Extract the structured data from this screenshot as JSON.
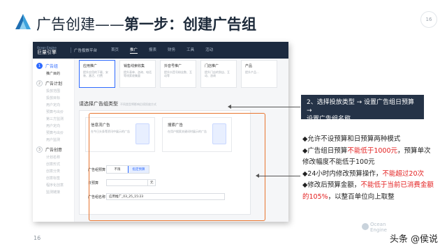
{
  "slide": {
    "title_prefix": "广告创建——",
    "title_bold": "第一步：创建广告组",
    "page_badge": "16",
    "page_number": "16",
    "watermark_line1": "Ocean",
    "watermark_line2": "Engine",
    "corner_credit": "头条 @侯说"
  },
  "screenshot": {
    "brand_en": "Ocean Engine",
    "brand_cn": "巨量引擎",
    "platform": "广告投放平台",
    "nav": [
      "首页",
      "推广",
      "报表",
      "财务",
      "工具",
      "活动"
    ],
    "nav_active_index": 1,
    "sidebar": {
      "steps": [
        {
          "num": "1",
          "label": "广告组",
          "subs": [
            "推广目的"
          ]
        },
        {
          "num": "2",
          "label": "广告计划",
          "subs": [
            "投放范围",
            "投放目标",
            "用户定向",
            "预算与出价",
            "第三方监测",
            "用户定向",
            "预算与出价",
            "用户监测"
          ]
        },
        {
          "num": "3",
          "label": "广告创意",
          "subs": [
            "计划名称",
            "创意形式",
            "创意分类",
            "创意标签",
            "程序化创意",
            "监测链接"
          ]
        }
      ]
    },
    "top_cards": [
      {
        "title": "应用推广",
        "desc": "提升应用的下载、安装、激活、付费"
      },
      {
        "title": "销售线索收集",
        "desc": "提升表单、咨询、电话等线索收集量"
      },
      {
        "title": "抖音号推广",
        "desc": "提升抖音号粉丝数、互动等"
      },
      {
        "title": "门店推广",
        "desc": "提升门店的到店、互动、咨询"
      },
      {
        "title": "产品",
        "desc": "提升产品..."
      }
    ],
    "section_title": "请选择广告组类型",
    "section_hint": "不同类型将影响后续投放方式",
    "type_cards": [
      {
        "title": "信息流广告",
        "desc": "在今日头条等资讯中展示的广告"
      },
      {
        "title": "搜索广告",
        "desc": "在用户搜索关键词时展示的广告"
      }
    ],
    "form": {
      "budget_label": "广告组预算",
      "budget_options": [
        "不限",
        "指定预算"
      ],
      "budget_selected": "指定预算",
      "daily_budget_label": "日预算",
      "daily_budget_unit": "元",
      "name_label": "广告组名称",
      "name_value": "应用推广_03_25_15:23"
    }
  },
  "callout": {
    "line1": "2、选择投放类型 → 设置广告组日预算→",
    "line2": "设置广告组名称"
  },
  "notes": [
    {
      "parts": [
        {
          "t": "◆允许不设预算和日预算两种模式",
          "red": false
        }
      ]
    },
    {
      "parts": [
        {
          "t": "◆广告组日预算",
          "red": false
        },
        {
          "t": "不能低于1000元",
          "red": true
        },
        {
          "t": "，预算单次",
          "red": false
        }
      ]
    },
    {
      "parts": [
        {
          "t": "修改幅度不能低于100元",
          "red": false
        }
      ]
    },
    {
      "parts": [
        {
          "t": "◆24小时内修改预算操作，",
          "red": false
        },
        {
          "t": "不能超过20次",
          "red": true
        }
      ]
    },
    {
      "parts": [
        {
          "t": "◆修改后预算金额，",
          "red": false
        },
        {
          "t": "不能低于当前已消费金额",
          "red": true
        }
      ]
    },
    {
      "parts": [
        {
          "t": "的105%",
          "red": true
        },
        {
          "t": "，以整百单位向上取整",
          "red": false
        }
      ]
    }
  ],
  "colors": {
    "accent_orange": "#e8742e",
    "accent_red": "#e31e1e",
    "brand_blue": "#2f6bff",
    "navbar": "#1c2a3f",
    "callout_bg": "#253347"
  }
}
